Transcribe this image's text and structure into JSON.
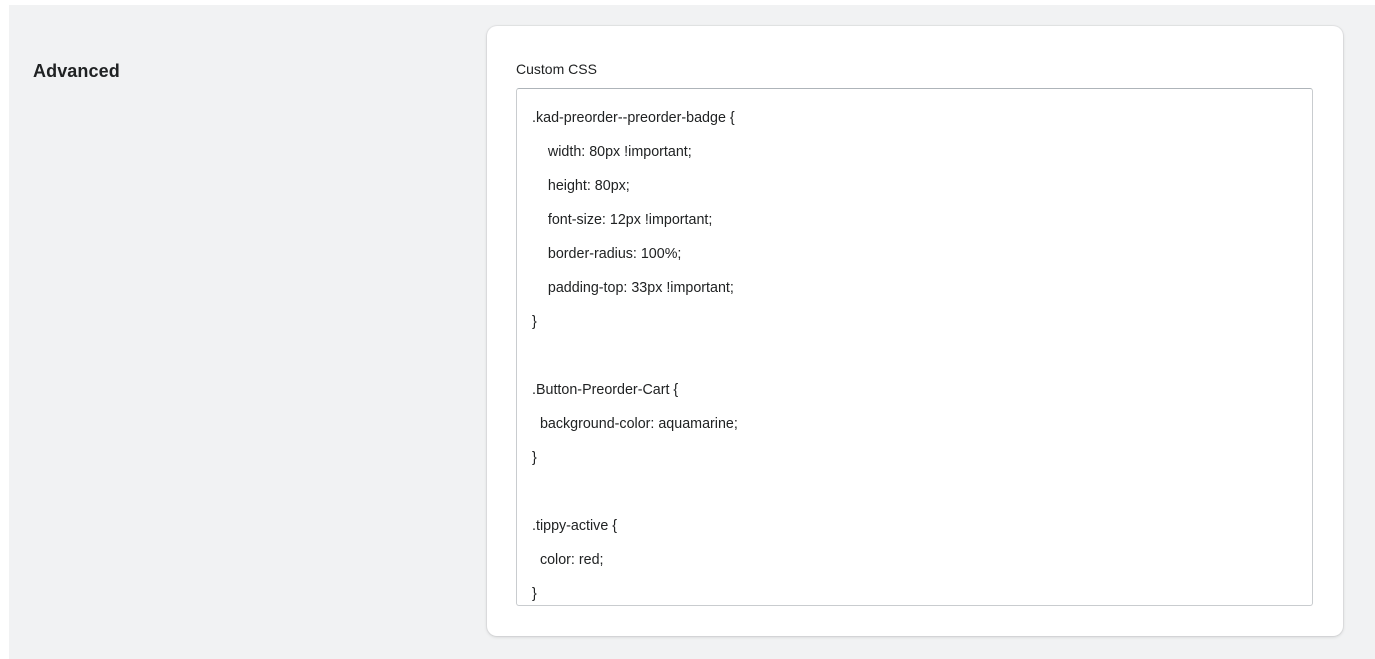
{
  "section": {
    "title": "Advanced"
  },
  "custom_css": {
    "label": "Custom CSS",
    "value": ".kad-preorder--preorder-badge {\n    width: 80px !important;\n    height: 80px;\n    font-size: 12px !important;\n    border-radius: 100%;\n    padding-top: 33px !important;\n}\n\n.Button-Preorder-Cart {\n  background-color: aquamarine;\n}\n\n.tippy-active {\n  color: red;\n}"
  },
  "colors": {
    "page_background": "#f1f2f3",
    "card_background": "#ffffff",
    "text": "#202223",
    "input_border": "#c9cccf"
  }
}
